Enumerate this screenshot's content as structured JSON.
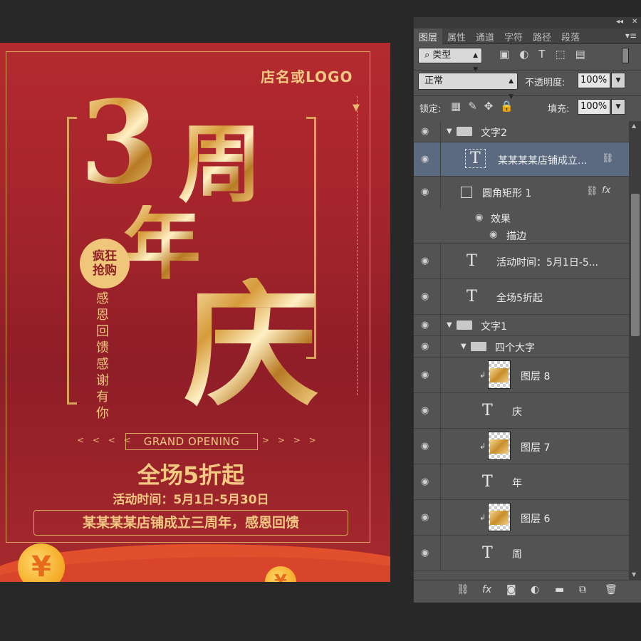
{
  "poster": {
    "logo": "店名或LOGO",
    "big_chars": [
      "3",
      "周",
      "年",
      "庆"
    ],
    "badge_line1": "疯狂",
    "badge_line2": "抢购",
    "vertical_text": "感恩回馈感谢有你",
    "arrows_left": "< < < <",
    "arrows_right": "> > > >",
    "grand_opening": "GRAND OPENING",
    "sale": "全场5折起",
    "dates": "活动时间：5月1日-5月30日",
    "slogan": "某某某某店铺成立三周年，感恩回馈",
    "coin_symbol": "¥",
    "colors": {
      "background": "#a3242b",
      "gold": "#f0c67a",
      "wave": "#e14f2c"
    }
  },
  "panel": {
    "tabs": [
      "图层",
      "属性",
      "通道",
      "字符",
      "路径",
      "段落"
    ],
    "active_tab": "图层",
    "filter_kind": "类型",
    "blend_mode": "正常",
    "opacity_label": "不透明度:",
    "opacity_value": "100%",
    "lock_label": "锁定:",
    "fill_label": "填充:",
    "fill_value": "100%",
    "layers": [
      {
        "type": "group",
        "name": "文字2",
        "indent": 0
      },
      {
        "type": "text",
        "name": "某某某某店铺成立...",
        "selected": true
      },
      {
        "type": "shape",
        "name": "圆角矩形 1",
        "fx": "fx"
      },
      {
        "type": "effects",
        "name": "效果"
      },
      {
        "type": "effect",
        "name": "描边"
      },
      {
        "type": "text",
        "name": "活动时间：5月1日-5..."
      },
      {
        "type": "text",
        "name": "全场5折起"
      },
      {
        "type": "group",
        "name": "文字1",
        "indent": 0
      },
      {
        "type": "group",
        "name": "四个大字",
        "indent": 1
      },
      {
        "type": "image",
        "name": "图层 8"
      },
      {
        "type": "text",
        "name": "庆"
      },
      {
        "type": "image",
        "name": "图层 7"
      },
      {
        "type": "text",
        "name": "年"
      },
      {
        "type": "image",
        "name": "图层 6"
      },
      {
        "type": "text",
        "name": "周"
      }
    ],
    "icons": {
      "visibility": "eye-icon",
      "link": "link-icon",
      "fx": "fx-icon"
    }
  }
}
